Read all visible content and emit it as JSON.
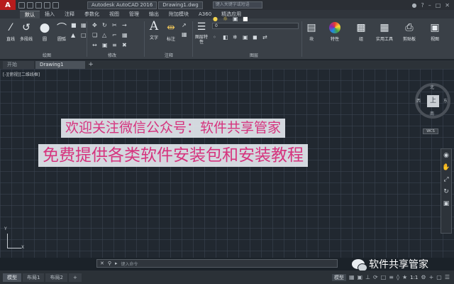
{
  "app": {
    "logo": "A",
    "window_title": "Autodesk AutoCAD 2016",
    "file_title": "Drawing1.dwg",
    "search_placeholder": "键入关键字或短语"
  },
  "ribbon_tabs": [
    "默认",
    "插入",
    "注释",
    "参数化",
    "视图",
    "管理",
    "输出",
    "附加模块",
    "A360",
    "精选应用"
  ],
  "ribbon": {
    "tools": {
      "line": "直线",
      "polyline": "多段线",
      "circle": "圆",
      "arc": "圆弧",
      "text": "文字",
      "dimension": "标注",
      "layer_props": "图层特性",
      "block": "块",
      "properties": "特性",
      "group": "组",
      "utilities": "实用工具",
      "clipboard": "剪贴板",
      "view": "视图"
    },
    "panels": {
      "draw": "绘图",
      "modify": "修改",
      "annotation": "注释",
      "layers": "图层"
    },
    "layer_value": "0"
  },
  "file_tabs": {
    "start": "开始",
    "drawing": "Drawing1",
    "add": "+"
  },
  "viewport": {
    "label": "[-][俯视][二维线框]",
    "compass": {
      "north": "北",
      "south": "南",
      "west": "西",
      "east": "东"
    },
    "cube_face": "上",
    "wcs": "WCS",
    "ucs_x": "X",
    "ucs_y": "Y"
  },
  "banners": {
    "line1": "欢迎关注微信公众号：软件共享管家",
    "line2": "免费提供各类软件安装包和安装教程"
  },
  "command_line": {
    "placeholder": "键入命令"
  },
  "watermark": {
    "text": "软件共享管家"
  },
  "status": {
    "tabs": [
      "模型",
      "布局1",
      "布局2"
    ],
    "model": "模型",
    "scale": "1:1"
  }
}
